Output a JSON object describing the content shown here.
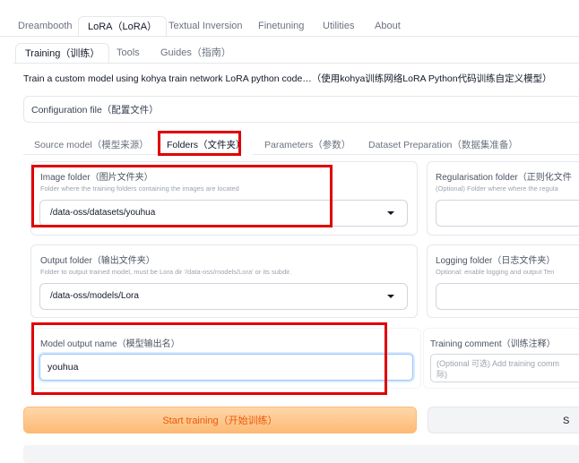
{
  "top_tabs": [
    "Dreambooth",
    "LoRA（LoRA）",
    "Textual Inversion",
    "Finetuning",
    "Utilities",
    "About"
  ],
  "sub_tabs": [
    "Training（训练）",
    "Tools",
    "Guides（指南）"
  ],
  "description": "Train a custom model using kohya train network LoRA python code…（使用kohya训练网络LoRA Python代码训练自定义模型）",
  "config_file_label": "Configuration file（配置文件）",
  "inner_tabs": [
    "Source model（模型来源）",
    "Folders（文件夹）",
    "Parameters（参数）",
    "Dataset Preparation（数据集准备）"
  ],
  "image_folder": {
    "label": "Image folder（图片文件夹）",
    "info": "Folder where the training folders containing the images are located",
    "value": "/data-oss/datasets/youhua"
  },
  "reg_folder": {
    "label": "Regularisation folder（正则化文件",
    "info": "(Optional) Folder where where the regula"
  },
  "output_folder": {
    "label": "Output folder（输出文件夹）",
    "info": "Folder to output trained model, must be Lora dir '/data-oss/models/Lora' or its subdir.",
    "value": "/data-oss/models/Lora"
  },
  "logging_folder": {
    "label": "Logging folder（日志文件夹）",
    "info": "Optional: enable logging and output Ten"
  },
  "model_output_name": {
    "label": "Model output name（模型输出名）",
    "value": "youhua"
  },
  "training_comment": {
    "label": "Training comment（训练注释）",
    "placeholder": "(Optional 可选) Add training comm",
    "placeholder_line2": "际)"
  },
  "start_button": "Start training（开始训练）",
  "stop_button": "S",
  "colors": {
    "highlight": "#e00000",
    "start_bg": "#fdba74",
    "start_text": "#ea580c"
  }
}
